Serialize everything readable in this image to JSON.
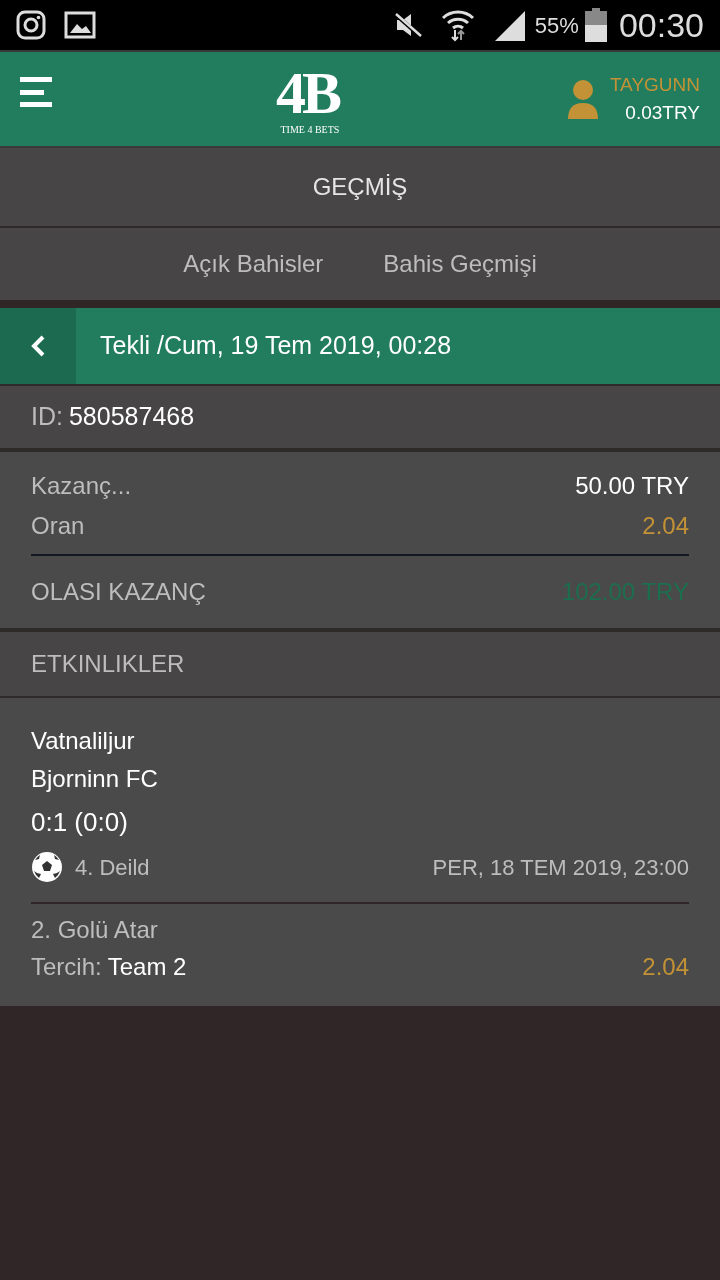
{
  "status_bar": {
    "battery": "55%",
    "time": "00:30"
  },
  "header": {
    "logo": "4B",
    "logo_tagline": "TIME 4 BETS",
    "username": "TAYGUNN",
    "balance": "0.03TRY"
  },
  "page_title": "GEÇMİŞ",
  "tabs": [
    {
      "label": "Açık Bahisler",
      "selected": false
    },
    {
      "label": "Bahis Geçmişi",
      "selected": false
    }
  ],
  "bet": {
    "title": "Tekli /Cum, 19 Tem 2019, 00:28",
    "id_label": "ID:",
    "id": "580587468",
    "summary": [
      {
        "label": "Kazanç...",
        "value": "50.00 TRY",
        "kind": "stake"
      },
      {
        "label": "Oran",
        "value": "2.04",
        "kind": "odds"
      }
    ],
    "total_label": "OLASI KAZANÇ",
    "total_value": "102.00 TRY",
    "events_title": "ETKINLIKLER",
    "events": [
      {
        "home": "Vatnaliljur",
        "away": "Bjorninn FC",
        "score": "0:1 (0:0)",
        "league": "4. Deild",
        "date": "PER, 18 TEM 2019, 23:00",
        "market": "2. Golü Atar",
        "pick_label": "Tercih:",
        "pick": "Team 2",
        "odds": "2.04"
      }
    ]
  }
}
